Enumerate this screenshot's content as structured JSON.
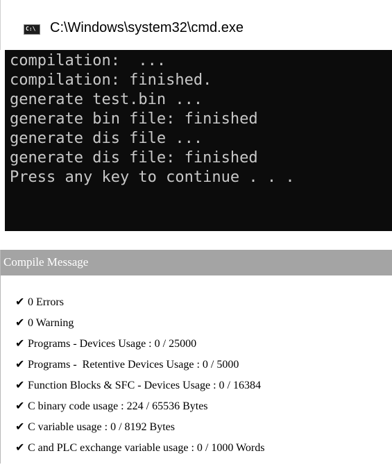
{
  "console": {
    "icon_label": "C:\\",
    "title": "C:\\Windows\\system32\\cmd.exe",
    "lines": [
      "compilation:  ...",
      "compilation: finished.",
      "generate test.bin ...",
      "generate bin file: finished",
      "generate dis file ...",
      "generate dis file: finished",
      "Press any key to continue . . ."
    ]
  },
  "compile_panel": {
    "title": "Compile Message",
    "check_glyph": "✔",
    "messages": [
      "0 Errors",
      "0 Warning",
      "Programs - Devices Usage : 0 / 25000",
      "Programs -  Retentive Devices Usage : 0 / 5000",
      "Function Blocks & SFC - Devices Usage : 0 / 16384",
      "C binary code usage : 224 / 65536 Bytes",
      "C variable usage : 0 / 8192 Bytes",
      "C and PLC exchange variable usage : 0 / 1000 Words"
    ]
  },
  "colors": {
    "terminal_bg": "#0c0c0c",
    "terminal_text": "#c8c8c8",
    "panel_header_bg": "#a4a4a4"
  }
}
